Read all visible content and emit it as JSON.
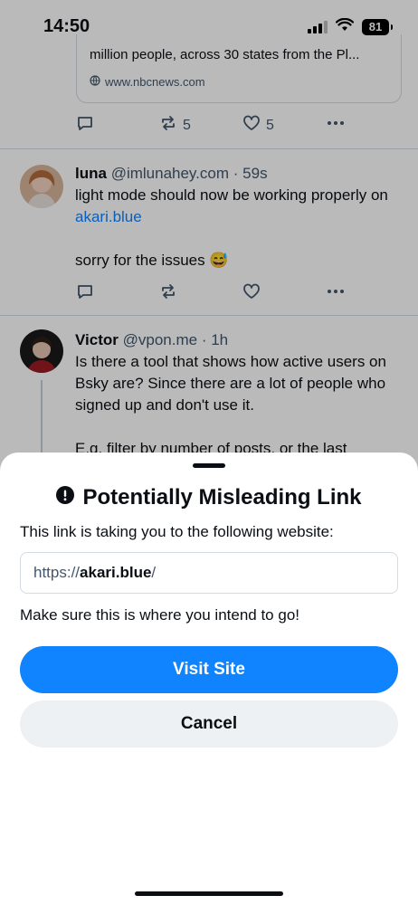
{
  "status_bar": {
    "time": "14:50",
    "battery": "81"
  },
  "feed": {
    "link_card": {
      "title": "million people, across 30 states from the Pl...",
      "domain": "www.nbcnews.com"
    },
    "first_post_actions": {
      "reposts": "5",
      "likes": "5"
    },
    "posts": [
      {
        "display_name": "luna",
        "handle": "@imlunahey.com",
        "time": "59s",
        "text_before_link": "light mode should now be working properly on ",
        "link_text": "akari.blue",
        "text_after": "sorry for the issues 😅"
      },
      {
        "display_name": "Victor",
        "handle": "@vpon.me",
        "time": "1h",
        "text": "Is there a tool that shows how active users on Bsky are? Since there are a lot of people who signed up and don't use it.",
        "text_2": "E.g. filter by number of posts, or the last"
      }
    ]
  },
  "dialog": {
    "title": "Potentially Misleading Link",
    "description": "This link is taking you to the following website:",
    "url_prefix": "https://",
    "url_host": "akari.blue",
    "url_suffix": "/",
    "note": "Make sure this is where you intend to go!",
    "visit_label": "Visit Site",
    "cancel_label": "Cancel"
  }
}
